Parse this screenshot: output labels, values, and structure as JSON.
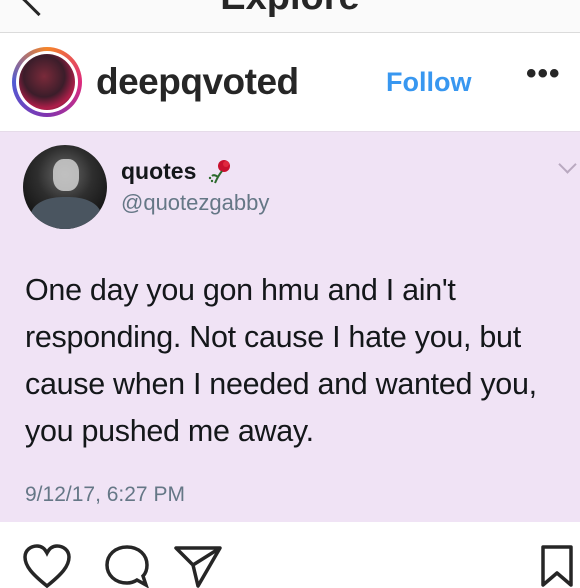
{
  "nav": {
    "title": "Explore",
    "back_icon": "chevron-left-icon"
  },
  "post": {
    "username": "deepqvoted",
    "follow_label": "Follow",
    "more_label": "•••",
    "follow_color": "#3897f0"
  },
  "tweet": {
    "name": "quotes",
    "name_icon": "rose-icon",
    "handle": "@quotezgabby",
    "text": "One day you gon hmu and I ain't responding. Not cause I hate you, but cause when I needed and wanted you, you pushed me away.",
    "timestamp": "9/12/17, 6:27 PM",
    "background": "#f0e3f5"
  },
  "actions": {
    "icons": [
      "heart-icon",
      "comment-icon",
      "share-icon",
      "bookmark-icon"
    ]
  }
}
